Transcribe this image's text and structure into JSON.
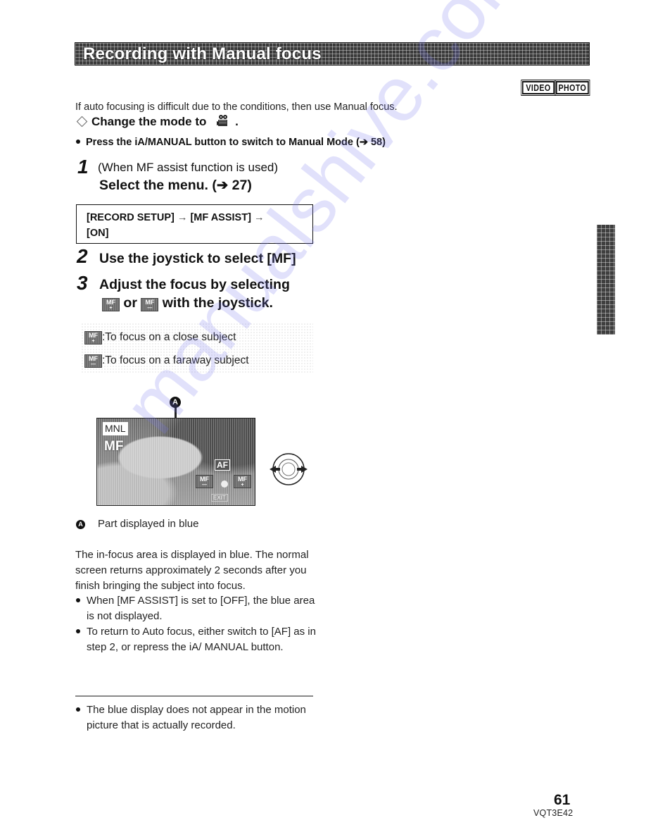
{
  "header": {
    "title": "Recording with Manual focus",
    "mode_badges": [
      "VIDEO",
      "PHOTO"
    ]
  },
  "intro": "If auto focusing is difficult due to the conditions, then use Manual focus.",
  "change_mode": {
    "text": "Change the mode to",
    "icon": "video-camera-mode-icon",
    "suffix": "."
  },
  "press_instruction": "Press the iA/MANUAL button to switch to Manual Mode (➔ 58)",
  "steps": [
    {
      "number": "1",
      "precondition": "(When MF assist function is used)",
      "title": "Select the menu. (➔ 27)",
      "menu_path": {
        "part1": "[RECORD SETUP]",
        "arrow": "→",
        "part2": "[MF ASSIST]",
        "part3": "[ON]"
      }
    },
    {
      "number": "2",
      "title": "Use the joystick to select [MF]"
    },
    {
      "number": "3",
      "title_line1": "Adjust the focus by selecting",
      "or_text": "or",
      "title_line2_suffix": "with the joystick."
    }
  ],
  "mf_icons": {
    "label": "MF",
    "near_sub": "+",
    "far_sub": "—"
  },
  "notes": [
    ":To focus on a close subject",
    ":To focus on a faraway subject"
  ],
  "illustration": {
    "marker": "A",
    "screen_labels": {
      "mnl": "MNL",
      "mf": "MF",
      "af": "AF",
      "mf_left": "MF",
      "mf_right": "MF",
      "exit": "EXIT"
    }
  },
  "legend": {
    "marker": "A",
    "text": "Part displayed in blue"
  },
  "body": {
    "paragraph": "The in-focus area is displayed in blue. The normal screen returns approximately 2 seconds after you finish bringing the subject into focus.",
    "bullets": [
      "When [MF ASSIST] is set to [OFF], the blue area is not displayed.",
      "To return to Auto focus, either switch to [AF] as in step 2, or repress the iA/ MANUAL button."
    ]
  },
  "footnote": "The blue display does not appear in the motion picture that is actually recorded.",
  "footer": {
    "page_number": "61",
    "doc_code": "VQT3E42"
  },
  "watermark": "manualshive.com"
}
